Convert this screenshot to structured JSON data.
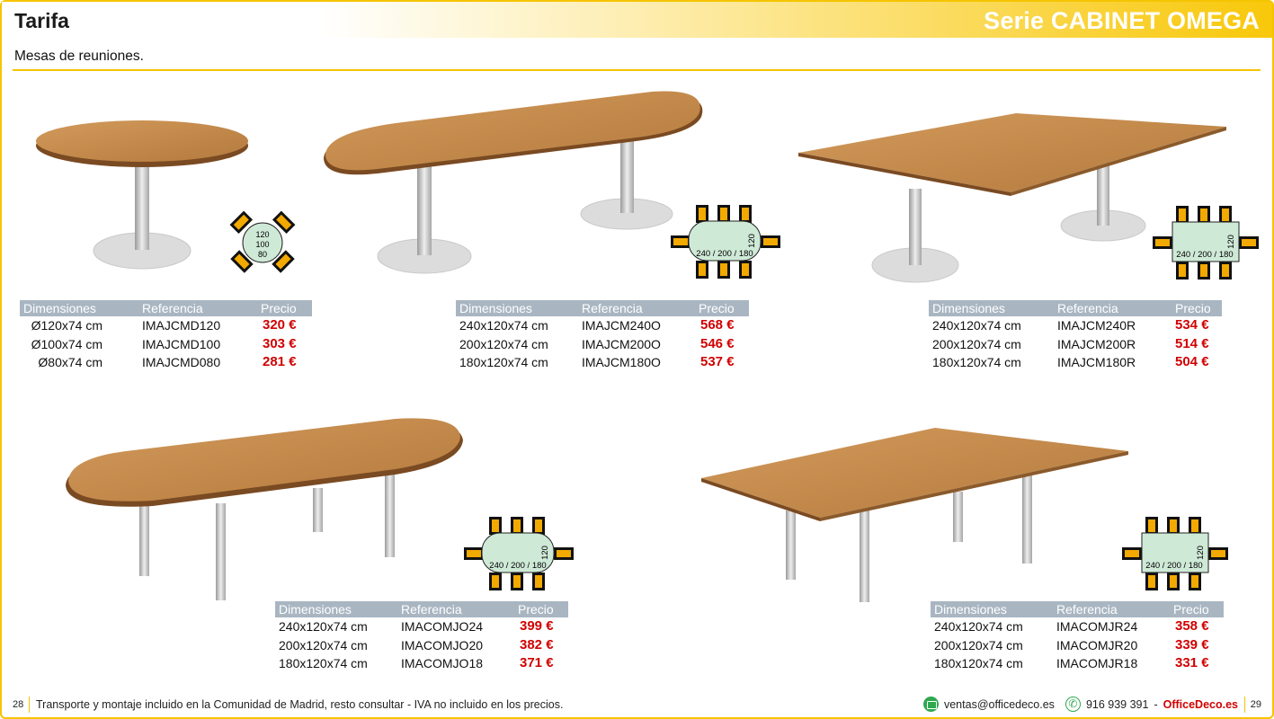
{
  "header": {
    "title": "Tarifa",
    "series": "Serie CABINET OMEGA"
  },
  "subtitle": "Mesas de reuniones.",
  "table_headers": {
    "dim": "Dimensiones",
    "ref": "Referencia",
    "price": "Precio"
  },
  "products": [
    {
      "diagram": {
        "d1": "120",
        "d2": "100",
        "d3": "80"
      },
      "rows": [
        {
          "dim": "Ø120x74 cm",
          "ref": "IMAJCMD120",
          "price": "320 €"
        },
        {
          "dim": "Ø100x74 cm",
          "ref": "IMAJCMD100",
          "price": "303 €"
        },
        {
          "dim": "Ø80x74 cm",
          "ref": "IMAJCMD080",
          "price": "281 €"
        }
      ]
    },
    {
      "diagram": {
        "length": "240 / 200 / 180",
        "width": "120"
      },
      "rows": [
        {
          "dim": "240x120x74 cm",
          "ref": "IMAJCM240O",
          "price": "568 €"
        },
        {
          "dim": "200x120x74 cm",
          "ref": "IMAJCM200O",
          "price": "546 €"
        },
        {
          "dim": "180x120x74 cm",
          "ref": "IMAJCM180O",
          "price": "537 €"
        }
      ]
    },
    {
      "diagram": {
        "length": "240 / 200 / 180",
        "width": "120"
      },
      "rows": [
        {
          "dim": "240x120x74 cm",
          "ref": "IMAJCM240R",
          "price": "534 €"
        },
        {
          "dim": "200x120x74 cm",
          "ref": "IMAJCM200R",
          "price": "514 €"
        },
        {
          "dim": "180x120x74 cm",
          "ref": "IMAJCM180R",
          "price": "504 €"
        }
      ]
    },
    {
      "diagram": {
        "length": "240 / 200 / 180",
        "width": "120"
      },
      "rows": [
        {
          "dim": "240x120x74 cm",
          "ref": "IMACOMJO24",
          "price": "399 €"
        },
        {
          "dim": "200x120x74 cm",
          "ref": "IMACOMJO20",
          "price": "382 €"
        },
        {
          "dim": "180x120x74 cm",
          "ref": "IMACOMJO18",
          "price": "371 €"
        }
      ]
    },
    {
      "diagram": {
        "length": "240 / 200 / 180",
        "width": "120"
      },
      "rows": [
        {
          "dim": "240x120x74 cm",
          "ref": "IMACOMJR24",
          "price": "358 €"
        },
        {
          "dim": "200x120x74 cm",
          "ref": "IMACOMJR20",
          "price": "339 €"
        },
        {
          "dim": "180x120x74 cm",
          "ref": "IMACOMJR18",
          "price": "331 €"
        }
      ]
    }
  ],
  "footer": {
    "page_left": "28",
    "note": "Transporte y montaje incluido en la Comunidad de Madrid, resto consultar - IVA no incluido en los precios.",
    "email": "ventas@officedeco.es",
    "phone": "916 939 391",
    "dash": "-",
    "brand": "OfficeDeco.es",
    "page_right": "29"
  },
  "colors": {
    "accent": "#f5c400",
    "price": "#d10000",
    "table_header": "#a9b6c2",
    "wood": "#c08a4e",
    "chair": "#f2a900"
  }
}
